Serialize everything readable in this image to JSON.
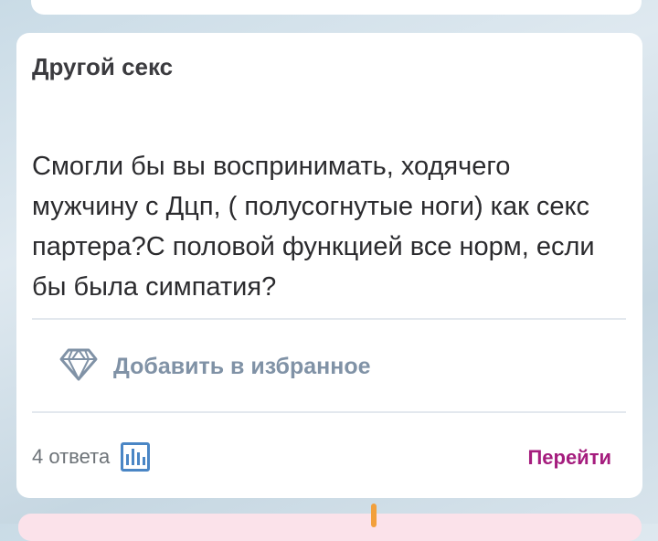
{
  "card": {
    "category": "Другой секс",
    "question": "Смогли бы вы воспринимать, ходячего мужчину с Дцп, ( полусогнутые ноги) как секс партера?С половой функцией все норм, если бы была симпатия?",
    "favorite_label": "Добавить в избранное",
    "answers_count": "4 ответа",
    "goto_label": "Перейти"
  },
  "icons": {
    "favorite": "diamond-icon",
    "stats": "bar-chart-icon"
  },
  "colors": {
    "accent_link": "#a51d7e",
    "stats_icon": "#4a86c5",
    "favorite_text": "#8092a6"
  }
}
